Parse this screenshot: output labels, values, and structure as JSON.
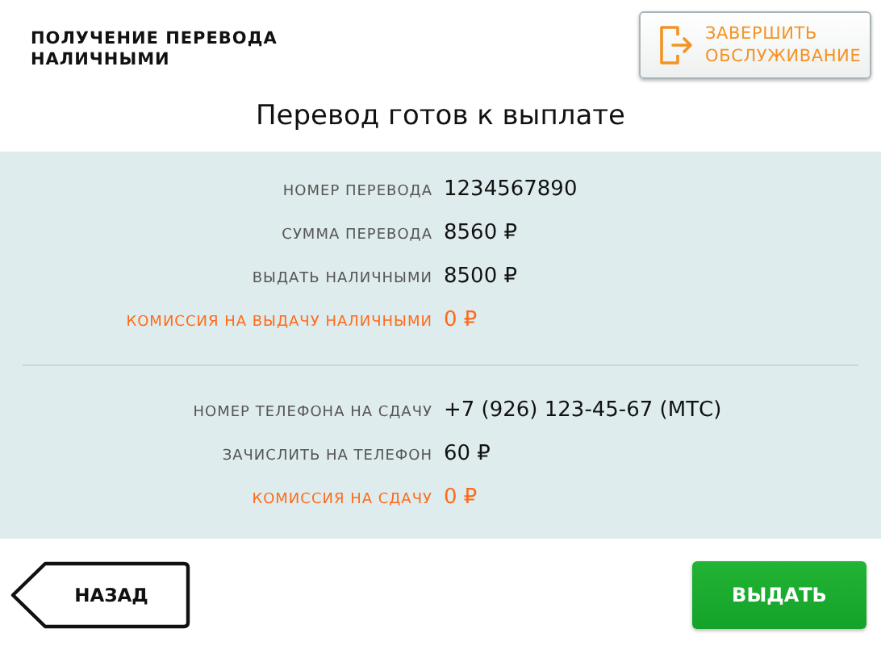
{
  "header": {
    "title": "ПОЛУЧЕНИЕ ПЕРЕВОДА НАЛИЧНЫМИ",
    "end_button": "ЗАВЕРШИТЬ ОБСЛУЖИВАНИЕ"
  },
  "heading": "Перевод готов к выплате",
  "groups": [
    {
      "rows": [
        {
          "kind": "normal",
          "label": "НОМЕР ПЕРЕВОДА",
          "value": "1234567890"
        },
        {
          "kind": "normal",
          "label": "СУММА ПЕРЕВОДА",
          "value": "8560 ₽"
        },
        {
          "kind": "normal",
          "label": "ВЫДАТЬ НАЛИЧНЫМИ",
          "value": "8500 ₽"
        },
        {
          "kind": "fee",
          "label": "КОМИССИЯ НА ВЫДАЧУ НАЛИЧНЫМИ",
          "value": "0 ₽"
        }
      ]
    },
    {
      "rows": [
        {
          "kind": "normal",
          "label": "НОМЕР ТЕЛЕФОНА НА СДАЧУ",
          "value": "+7 (926) 123-45-67 (МТС)"
        },
        {
          "kind": "normal",
          "label": "ЗАЧИСЛИТЬ НА ТЕЛЕФОН",
          "value": "60 ₽"
        },
        {
          "kind": "fee",
          "label": "КОМИССИЯ НА СДАЧУ",
          "value": "0 ₽"
        }
      ]
    }
  ],
  "footer": {
    "back_button": "НАЗАД",
    "dispense_button": "ВЫДАТЬ"
  }
}
